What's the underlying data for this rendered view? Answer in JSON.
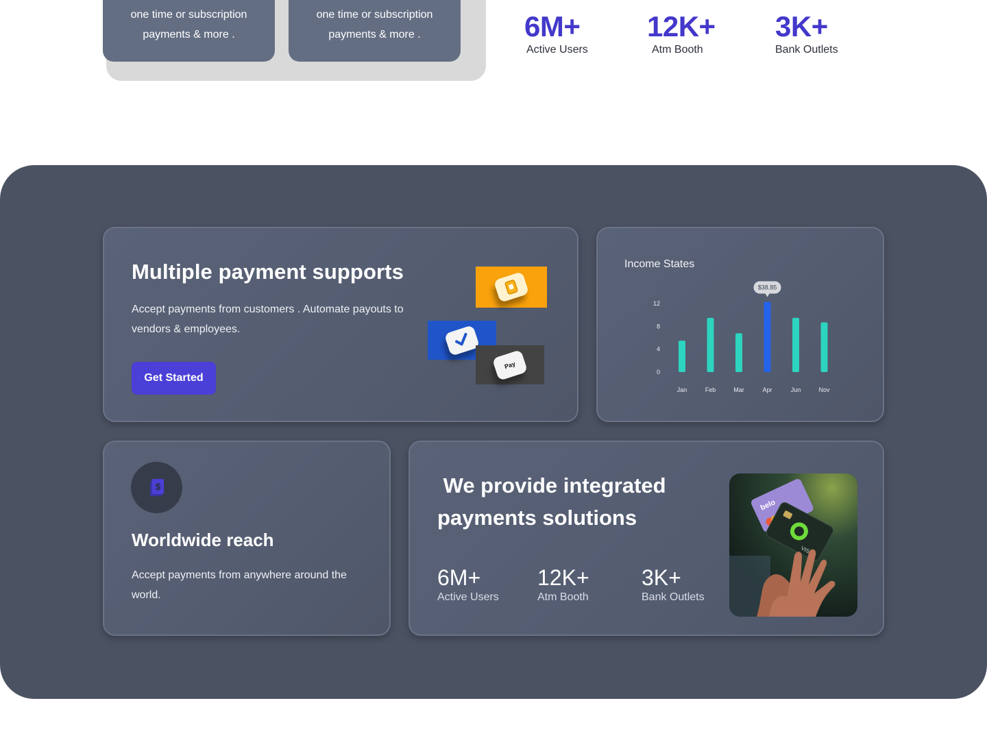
{
  "top_cards": [
    {
      "line1": "one time or subscription",
      "line2": "payments & more ."
    },
    {
      "line1": "one time or subscription",
      "line2": "payments & more ."
    }
  ],
  "top_stats": [
    {
      "value": "6M+",
      "label": "Active Users"
    },
    {
      "value": "12K+",
      "label": "Atm Booth"
    },
    {
      "value": "3K+",
      "label": "Bank Outlets"
    }
  ],
  "payment_card": {
    "title": "Multiple payment supports",
    "description": "Accept payments from customers . Automate payouts to vendors & employees.",
    "button_label": "Get Started",
    "apple_pay_label": "Pay"
  },
  "income_card": {
    "title": "Income States"
  },
  "chart_data": {
    "type": "bar",
    "categories": [
      "Jan",
      "Feb",
      "Mar",
      "Apr",
      "Jun",
      "Nov"
    ],
    "values": [
      5.5,
      9.5,
      6.8,
      12.3,
      9.5,
      8.7
    ],
    "y_ticks": [
      0,
      4,
      8,
      12
    ],
    "ylim": [
      0,
      12
    ],
    "highlight_index": 3,
    "tooltip": "$38.85",
    "bar_color": "#2dd4bf",
    "highlight_color": "#2563eb"
  },
  "world_card": {
    "title": "Worldwide reach",
    "description": "Accept payments from anywhere around the world.",
    "icon": "money-document-icon"
  },
  "integrated_card": {
    "title": " We provide integrated payments solutions",
    "stats": [
      {
        "value": "6M+",
        "label": "Active Users"
      },
      {
        "value": "12K+",
        "label": "Atm Booth"
      },
      {
        "value": "3K+",
        "label": "Bank Outlets"
      }
    ],
    "photo_card_brand": "belo",
    "photo_card_network": "VISA"
  },
  "colors": {
    "accent": "#4338ca",
    "button": "#4a3fd6",
    "section_bg": "#4b5262"
  }
}
